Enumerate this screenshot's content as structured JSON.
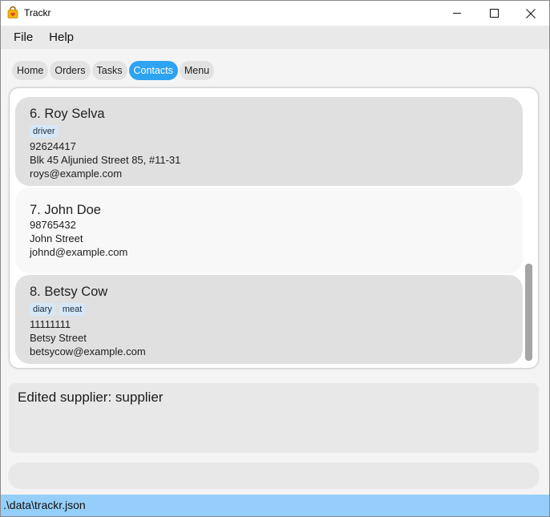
{
  "window": {
    "title": "Trackr"
  },
  "menu": {
    "file": "File",
    "help": "Help"
  },
  "tabs": [
    {
      "label": "Home",
      "active": false
    },
    {
      "label": "Orders",
      "active": false
    },
    {
      "label": "Tasks",
      "active": false
    },
    {
      "label": "Contacts",
      "active": true
    },
    {
      "label": "Menu",
      "active": false
    }
  ],
  "contacts": [
    {
      "name": "6.  Roy Selva",
      "tags": [
        "driver"
      ],
      "phone": "92624417",
      "address": "Blk 45 Aljunied Street 85, #11-31",
      "email": "roys@example.com"
    },
    {
      "name": "7.  John Doe",
      "tags": [],
      "phone": "98765432",
      "address": "John Street",
      "email": "johnd@example.com"
    },
    {
      "name": "8.  Betsy Cow",
      "tags": [
        "diary",
        "meat"
      ],
      "phone": "11111111",
      "address": "Betsy Street",
      "email": "betsycow@example.com"
    }
  ],
  "result": {
    "text": "Edited supplier: supplier"
  },
  "command": {
    "value": "",
    "placeholder": ""
  },
  "status": {
    "path": ".\\data\\trackr.json"
  },
  "colors": {
    "accent": "#2ea3f2",
    "status_bar": "#95cff9",
    "tag_bg": "#d6e8f7"
  },
  "icons": {
    "app": "shopping-bag-icon",
    "minimize": "minimize-icon",
    "maximize": "maximize-icon",
    "close": "close-icon"
  }
}
